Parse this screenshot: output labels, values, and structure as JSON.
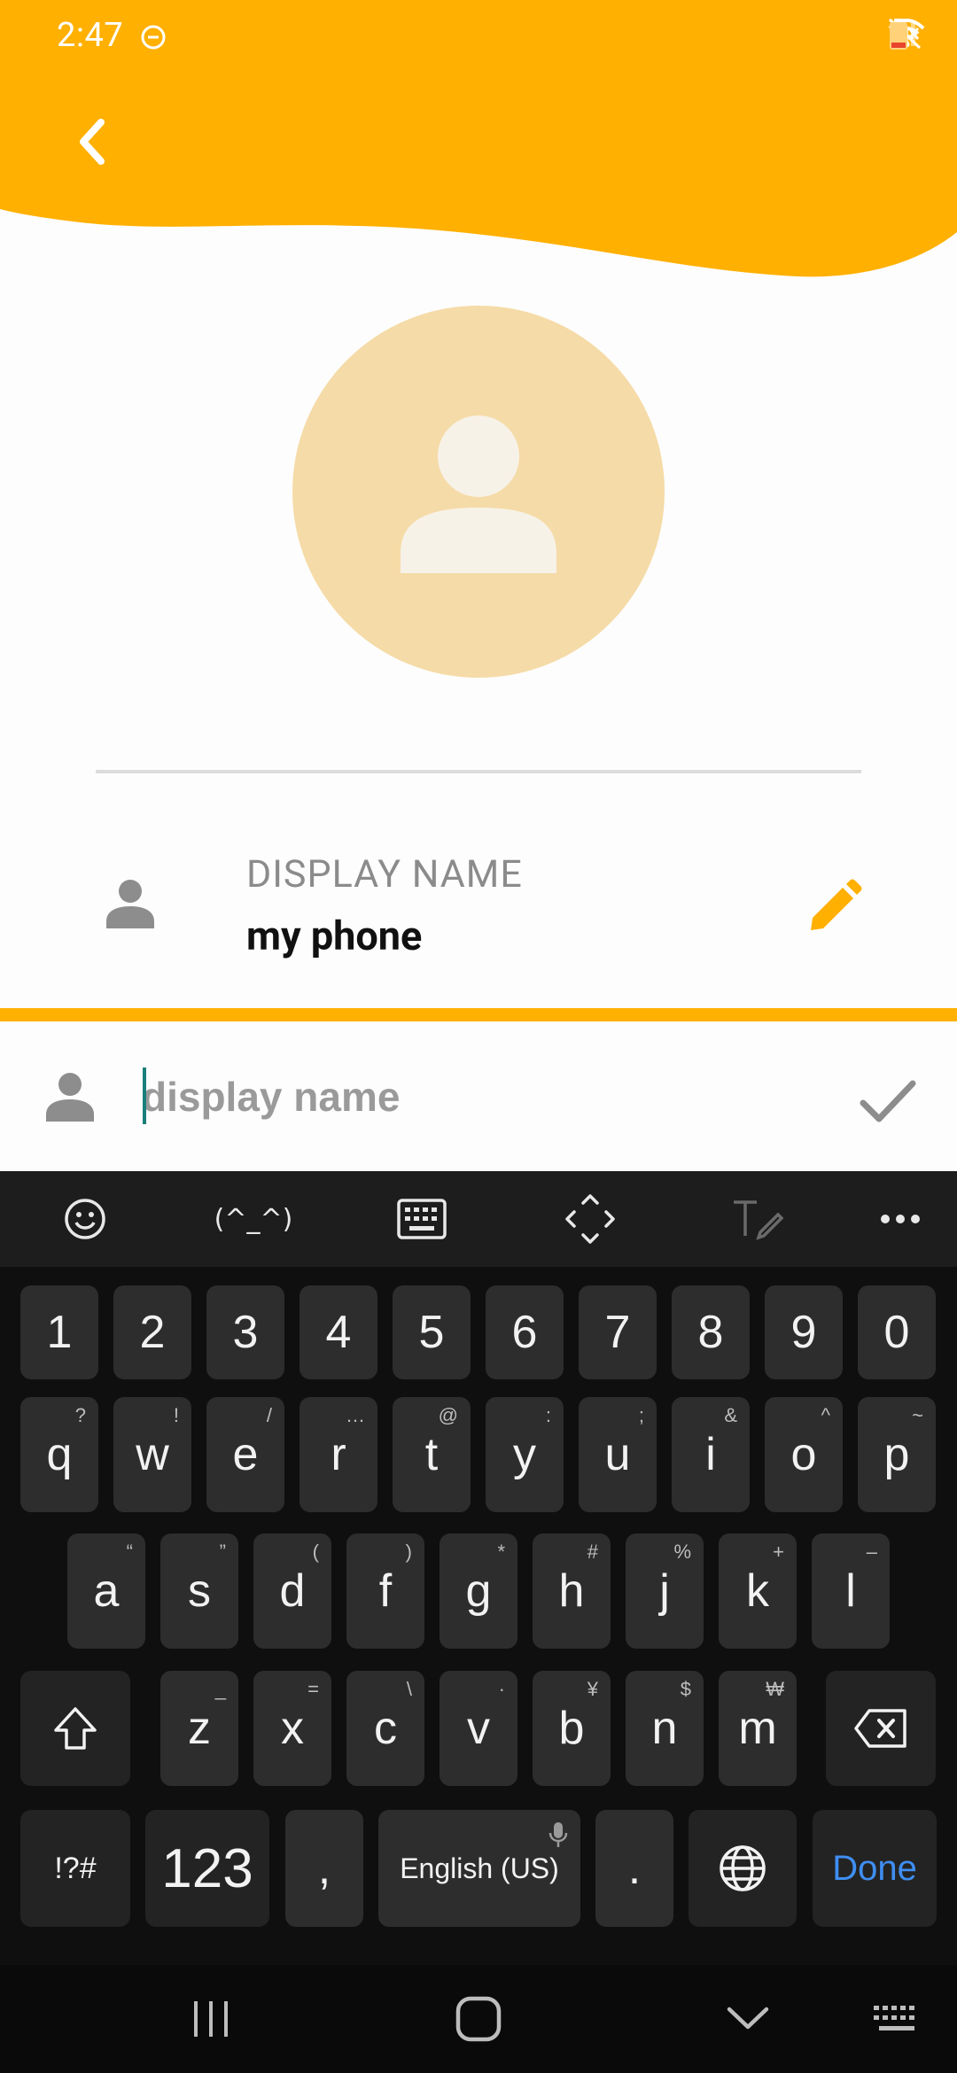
{
  "status_bar": {
    "time": "2:47",
    "icons": [
      "do-not-disturb-icon",
      "mute-icon",
      "wifi-icon",
      "signal-icon",
      "battery-low-icon"
    ]
  },
  "colors": {
    "accent": "#ffb000",
    "avatar_bg": "#f5dba7",
    "done_blue": "#3f8ef2"
  },
  "profile": {
    "display_name_label": "DISPLAY NAME",
    "display_name_value": "my phone"
  },
  "edit_field": {
    "placeholder": "display name",
    "value": ""
  },
  "keyboard": {
    "toolbar": [
      "emoji-icon",
      "(^_^)",
      "keyboard-icon",
      "cursor-move-icon",
      "handwriting-icon",
      "more-icon"
    ],
    "kaomoji_label": "(^_^)",
    "row_numbers": [
      "1",
      "2",
      "3",
      "4",
      "5",
      "6",
      "7",
      "8",
      "9",
      "0"
    ],
    "row_q": [
      {
        "k": "q",
        "h": "?"
      },
      {
        "k": "w",
        "h": "!"
      },
      {
        "k": "e",
        "h": "/"
      },
      {
        "k": "r",
        "h": "…"
      },
      {
        "k": "t",
        "h": "@"
      },
      {
        "k": "y",
        "h": ":"
      },
      {
        "k": "u",
        "h": ";"
      },
      {
        "k": "i",
        "h": "&"
      },
      {
        "k": "o",
        "h": "^"
      },
      {
        "k": "p",
        "h": "~"
      }
    ],
    "row_a": [
      {
        "k": "a",
        "h": "“"
      },
      {
        "k": "s",
        "h": "”"
      },
      {
        "k": "d",
        "h": "("
      },
      {
        "k": "f",
        "h": ")"
      },
      {
        "k": "g",
        "h": "*"
      },
      {
        "k": "h",
        "h": "#"
      },
      {
        "k": "j",
        "h": "%"
      },
      {
        "k": "k",
        "h": "+"
      },
      {
        "k": "l",
        "h": "–"
      }
    ],
    "row_z": [
      {
        "k": "z",
        "h": "_"
      },
      {
        "k": "x",
        "h": "="
      },
      {
        "k": "c",
        "h": "\\"
      },
      {
        "k": "v",
        "h": "·"
      },
      {
        "k": "b",
        "h": "¥"
      },
      {
        "k": "n",
        "h": "$"
      },
      {
        "k": "m",
        "h": "₩"
      }
    ],
    "symbols_label": "!?#",
    "numbers_label": "123",
    "comma": ",",
    "space_label": "English (US)",
    "period": ".",
    "done_label": "Done"
  }
}
